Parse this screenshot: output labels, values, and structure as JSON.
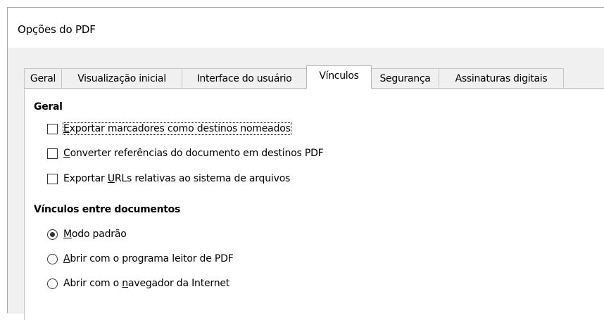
{
  "window": {
    "title": "Opções do PDF"
  },
  "tabs": [
    {
      "label": "Geral",
      "active": false
    },
    {
      "label": "Visualização inicial",
      "active": false
    },
    {
      "label": "Interface do usuário",
      "active": false
    },
    {
      "label": "Vínculos",
      "active": true
    },
    {
      "label": "Segurança",
      "active": false
    },
    {
      "label": "Assinaturas digitais",
      "active": false
    }
  ],
  "general": {
    "heading": "Geral",
    "options": [
      {
        "mnemonic": "E",
        "rest": "xportar marcadores como destinos nomeados",
        "checked": false,
        "focused": true
      },
      {
        "mnemonic": "C",
        "rest": "onverter referências do documento em destinos PDF",
        "checked": false,
        "focused": false
      },
      {
        "pre": "Exportar ",
        "mnemonic": "U",
        "rest": "RLs relativas ao sistema de arquivos",
        "checked": false,
        "focused": false
      }
    ]
  },
  "cross_doc": {
    "heading": "Vínculos entre documentos",
    "options": [
      {
        "mnemonic": "M",
        "rest": "odo padrão",
        "selected": true
      },
      {
        "mnemonic": "A",
        "rest": "brir com o programa leitor de PDF",
        "selected": false
      },
      {
        "pre": "Abrir com o ",
        "mnemonic": "n",
        "rest": "avegador da Internet",
        "selected": false
      }
    ]
  }
}
